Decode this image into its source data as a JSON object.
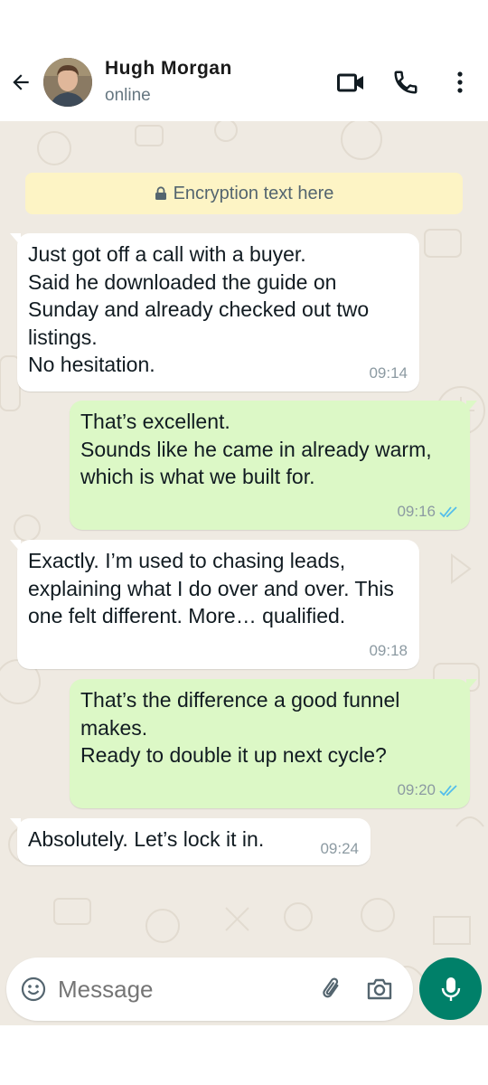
{
  "header": {
    "contact_name": "Hugh Morgan",
    "status": "online"
  },
  "encryption_notice": "Encryption text here",
  "messages": [
    {
      "direction": "in",
      "text": "Just got off a call with a buyer.\nSaid he downloaded the guide on Sunday and already checked out two listings.\nNo hesitation.",
      "time": "09:14"
    },
    {
      "direction": "out",
      "text": "That’s excellent.\nSounds like he came in already warm, which is what we built for.",
      "time": "09:16",
      "read": true
    },
    {
      "direction": "in",
      "text": "Exactly. I’m used to chasing leads, explaining what I do over and over. This one felt different. More… qualified.",
      "time": "09:18"
    },
    {
      "direction": "out",
      "text": "That’s the difference a good funnel makes.\nReady to double it up next cycle?",
      "time": "09:20",
      "read": true
    },
    {
      "direction": "in",
      "text": "Absolutely. Let’s lock it in.",
      "time": "09:24"
    }
  ],
  "composer": {
    "placeholder": "Message"
  },
  "colors": {
    "accent": "#008069",
    "incoming_bubble": "#ffffff",
    "outgoing_bubble": "#dcf8c6",
    "chat_background": "#efeae2",
    "encryption_banner": "#fdf4c5",
    "read_ticks": "#53bdeb"
  },
  "icons": {
    "back": "arrow-left-icon",
    "video": "video-camera-icon",
    "call": "phone-icon",
    "menu": "more-vertical-icon",
    "lock": "lock-icon",
    "emoji": "emoji-icon",
    "attach": "paperclip-icon",
    "camera": "camera-icon",
    "mic": "microphone-icon"
  }
}
